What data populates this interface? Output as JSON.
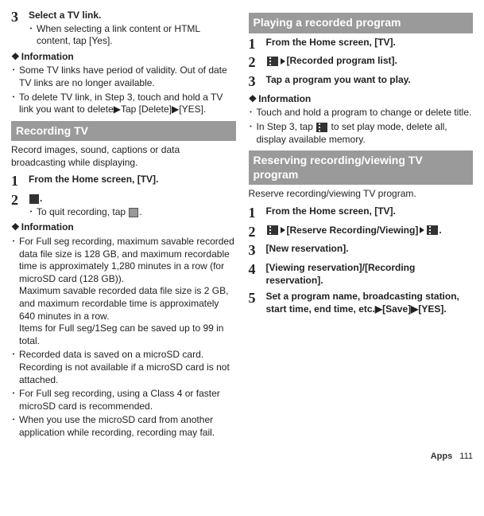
{
  "left": {
    "step3": {
      "num": "3",
      "title": "Select a TV link.",
      "sub": "When selecting a link content or HTML content, tap [Yes]."
    },
    "info1_head": "Information",
    "info1": [
      "Some TV links have period of validity. Out of date TV links are no longer available.",
      "To delete TV link, in Step 3, touch and hold a TV link you want to delete▶Tap [Delete]▶[YES]."
    ],
    "rec_head": "Recording TV",
    "rec_intro": "Record images, sound, captions or data broadcasting while displaying.",
    "rec_steps": {
      "s1": {
        "num": "1",
        "title": "From the Home screen, [TV]."
      },
      "s2": {
        "num": "2",
        "title_suffix": ".",
        "sub": "To quit recording, tap "
      }
    },
    "info2_head": "Information",
    "info2_a": "For Full seg recording, maximum savable recorded data file size is 128 GB, and maximum recordable time is approximately 1,280 minutes in a row (for microSD card (128 GB)).",
    "info2_a2": "Maximum savable recorded data file size is 2 GB, and maximum recordable time is approximately 640 minutes in a row.",
    "info2_a3": "Items for Full seg/1Seg can be saved up to 99 in total.",
    "info2_b": "Recorded data is saved on a microSD card. Recording is not available if a microSD card is not attached.",
    "info2_c": "For Full seg recording, using a Class 4 or faster microSD card is recommended.",
    "info2_d": "When you use the microSD card from another application while recording, recording may fail."
  },
  "right": {
    "play_head": "Playing a recorded program",
    "play_steps": {
      "s1": {
        "num": "1",
        "title": "From the Home screen, [TV]."
      },
      "s2": {
        "num": "2",
        "title": "[Recorded program list]."
      },
      "s3": {
        "num": "3",
        "title": "Tap a program you want to play."
      }
    },
    "info_head": "Information",
    "info": {
      "a": "Touch and hold a program to change or delete title.",
      "b_pre": "In Step 3, tap ",
      "b_post": " to set play mode, delete all, display available memory."
    },
    "reserve_head": "Reserving recording/viewing TV program",
    "reserve_intro": "Reserve recording/viewing TV program.",
    "reserve_steps": {
      "s1": {
        "num": "1",
        "title": "From the Home screen, [TV]."
      },
      "s2": {
        "num": "2",
        "t1": "[Reserve Recording/Viewing]"
      },
      "s3": {
        "num": "3",
        "title": "[New reservation]."
      },
      "s4": {
        "num": "4",
        "title": "[Viewing reservation]/[Recording reservation]."
      },
      "s5": {
        "num": "5",
        "title": "Set a program name, broadcasting station, start time, end time, etc.▶[Save]▶[YES]."
      }
    }
  },
  "footer": {
    "apps": "Apps",
    "page": "111"
  }
}
